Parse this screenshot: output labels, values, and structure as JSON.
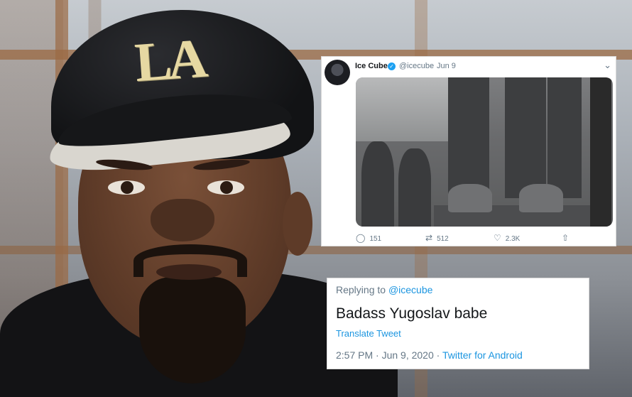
{
  "tweet": {
    "name": "Ice Cube",
    "handle": "@icecube",
    "separator": "·",
    "date": "Jun 9",
    "actions": {
      "reply_count": "151",
      "retweet_count": "512",
      "like_count": "2.3K"
    },
    "icons": {
      "verified": "verified-badge-icon",
      "caret": "chevron-down-icon",
      "reply": "reply-icon",
      "retweet": "retweet-icon",
      "like": "heart-icon",
      "share": "share-icon"
    }
  },
  "reply": {
    "replying_prefix": "Replying to",
    "replying_handle": "@icecube",
    "text": "Badass Yugoslav babe",
    "translate_label": "Translate Tweet",
    "timestamp": "2:57 PM · Jun 9, 2020 · ",
    "source": "Twitter for Android"
  },
  "photo": {
    "cap_logo": "LA"
  },
  "colors": {
    "accent": "#1b95e0",
    "text_primary": "#14171a",
    "text_secondary": "#657786"
  }
}
